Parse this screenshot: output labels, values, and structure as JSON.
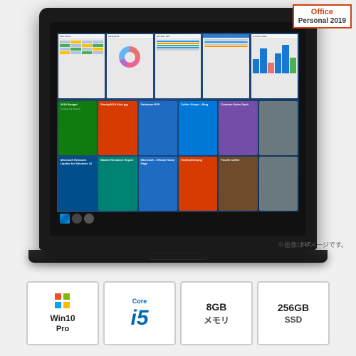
{
  "badge": {
    "office_line1": "Office",
    "office_line2": "Personal 2019"
  },
  "laptop": {
    "brand": "X1E",
    "image_notice": "※画像はイメージです。"
  },
  "specs": [
    {
      "id": "windows",
      "line1": "Win10",
      "line2": "Pro"
    },
    {
      "id": "cpu",
      "brand": "Core",
      "model": "i5"
    },
    {
      "id": "memory",
      "amount": "8GB",
      "label": "メモリ"
    },
    {
      "id": "storage",
      "amount": "256GB",
      "label": "SSD"
    }
  ],
  "screen": {
    "thumbnails": [
      {
        "title": "Slide Show",
        "type": "spreadsheet"
      },
      {
        "title": "Family2019...",
        "type": "donut"
      },
      {
        "title": "Fabricam RFP",
        "type": "lines"
      },
      {
        "title": "Coffee Shops - Bing",
        "type": "browser"
      },
      {
        "title": "Contoso Sales Dash",
        "type": "bar"
      }
    ],
    "tiles": [
      {
        "title": "2019 Budget",
        "color": "tile-green"
      },
      {
        "title": "Family2019_Kids.png",
        "color": "tile-orange"
      },
      {
        "title": "Fabricam RFP",
        "color": "tile-blue"
      },
      {
        "title": "Coffee Shops - Bing",
        "color": "tile-lightblue"
      },
      {
        "title": "Contoso Sales Dash",
        "color": "tile-purple"
      },
      {
        "title": "",
        "color": "tile-gray"
      },
      {
        "title": "Microsoft Releases Update",
        "color": "tile-darkblue"
      },
      {
        "title": "Market Research Report",
        "color": "tile-teal"
      },
      {
        "title": "Microsoft - Official Home Page",
        "color": "tile-blue"
      },
      {
        "title": "Family2019.png",
        "color": "tile-orange"
      },
      {
        "title": "Fourth Coffee",
        "color": "tile-brown"
      },
      {
        "title": "",
        "color": "tile-gray"
      }
    ]
  }
}
